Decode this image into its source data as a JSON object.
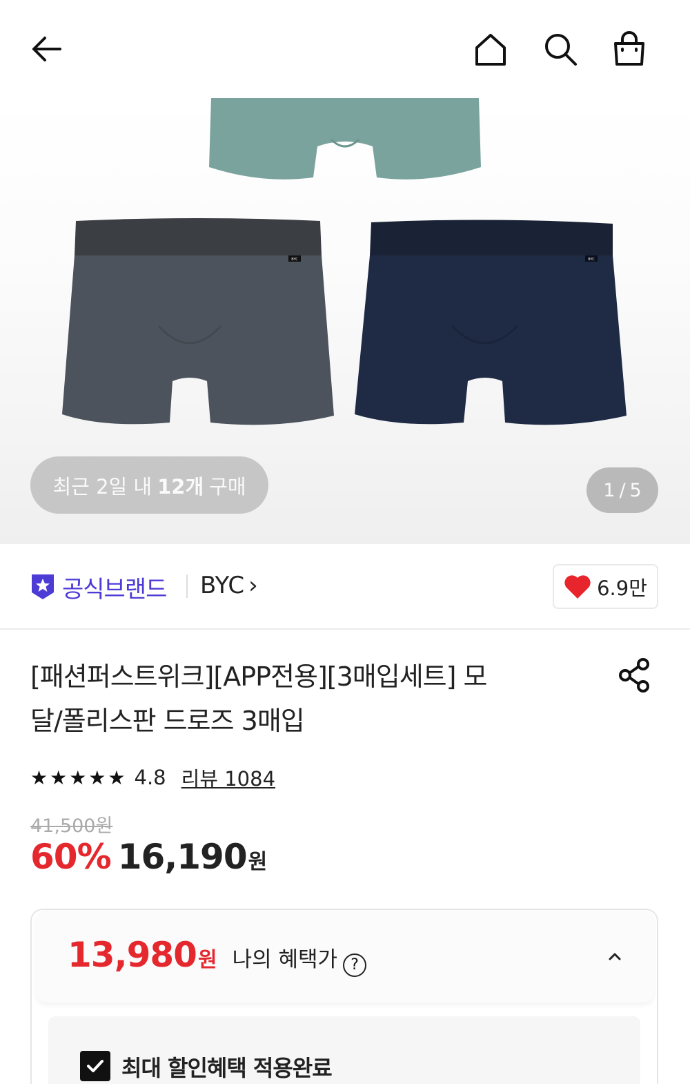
{
  "header": {
    "icons": [
      "back-arrow-icon",
      "home-icon",
      "search-icon",
      "shopping-bag-icon"
    ]
  },
  "hero": {
    "purchase_prefix": "최근 2일 내",
    "purchase_count": "12개",
    "purchase_suffix": "구매",
    "page_current": "1",
    "page_sep": "/",
    "page_total": "5",
    "product_colors": {
      "mint": "#7aa39e",
      "charcoal": "#4d535c",
      "navy": "#1f2b45"
    },
    "waistband_label": "BYC"
  },
  "brand": {
    "official_label": "공식브랜드",
    "name": "BYC",
    "chevron": "›",
    "like_count": "6.9만",
    "accent_color": "#4d3bd6",
    "heart_color": "#e8242c"
  },
  "product": {
    "title_line1": "[패션퍼스트위크][APP전용][3매입세트] 모",
    "title_line2": "달/폴리스판 드로즈 3매입",
    "stars": "★★★★★",
    "rating": "4.8",
    "review_label": "리뷰 1084"
  },
  "price": {
    "original": "41,500원",
    "discount": "60%",
    "sale": "16,190",
    "unit": "원",
    "discount_color": "#e5282e"
  },
  "benefit": {
    "price": "13,980",
    "unit": "원",
    "label": "나의 혜택가",
    "help": "?",
    "checkbox_label": "최대 할인혜택 적용완료",
    "checked": true
  }
}
